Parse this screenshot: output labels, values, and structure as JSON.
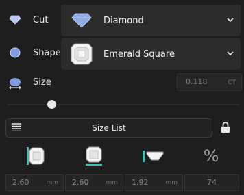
{
  "cut": {
    "label": "Cut",
    "value": "Diamond",
    "icon": "diamond-icon"
  },
  "shape": {
    "label": "Shape",
    "value": "Emerald Square",
    "icon": "emerald-square-icon"
  },
  "size": {
    "label": "Size",
    "value": "0.118",
    "unit": "CT",
    "slider_fraction": 0.17
  },
  "size_list": {
    "label": "Size List"
  },
  "dimensions": [
    {
      "name": "length",
      "icon": "length-icon",
      "value": "2.60",
      "unit": "mm"
    },
    {
      "name": "width",
      "icon": "width-icon",
      "value": "2.60",
      "unit": "mm"
    },
    {
      "name": "depth",
      "icon": "depth-icon",
      "value": "1.92",
      "unit": "mm"
    },
    {
      "name": "percent",
      "icon": "percent-icon",
      "value": "74",
      "unit": ""
    }
  ],
  "percent_symbol": "%"
}
